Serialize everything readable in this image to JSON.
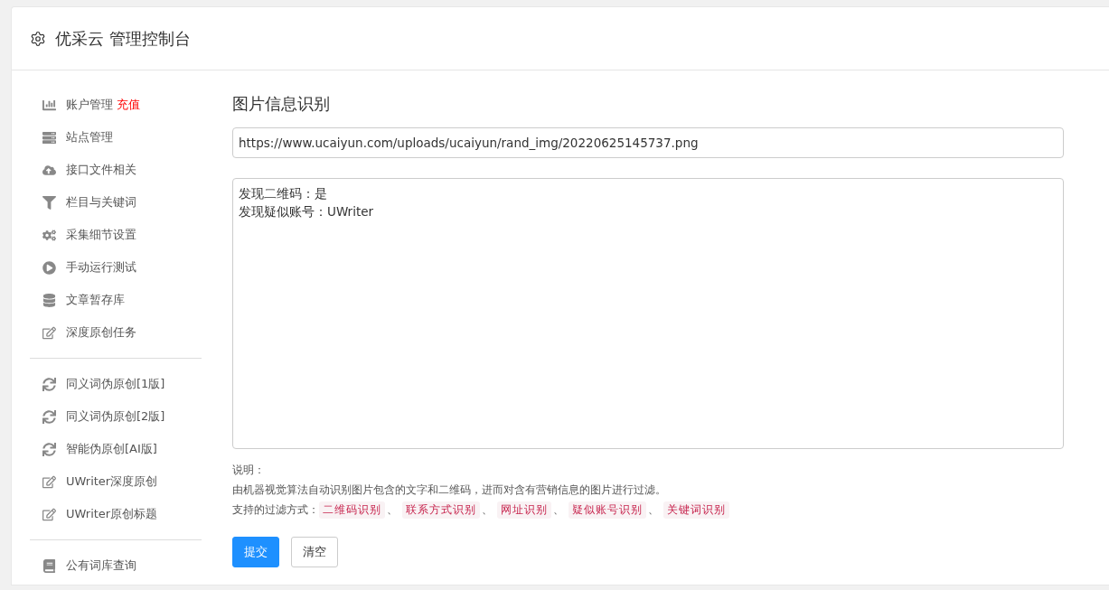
{
  "header": {
    "title": "优采云 管理控制台"
  },
  "sidebar": {
    "groups": [
      {
        "items": [
          {
            "kind": "chart",
            "label": "账户管理",
            "badge": "充值"
          },
          {
            "kind": "server",
            "label": "站点管理"
          },
          {
            "kind": "cloud",
            "label": "接口文件相关"
          },
          {
            "kind": "filter",
            "label": "栏目与关键词"
          },
          {
            "kind": "cogs",
            "label": "采集细节设置"
          },
          {
            "kind": "play",
            "label": "手动运行测试"
          },
          {
            "kind": "database",
            "label": "文章暂存库"
          },
          {
            "kind": "edit",
            "label": "深度原创任务"
          }
        ]
      },
      {
        "items": [
          {
            "kind": "sync",
            "label": "同义词伪原创[1版]"
          },
          {
            "kind": "sync",
            "label": "同义词伪原创[2版]"
          },
          {
            "kind": "sync",
            "label": "智能伪原创[AI版]"
          },
          {
            "kind": "edit",
            "label": "UWriter深度原创"
          },
          {
            "kind": "edit",
            "label": "UWriter原创标题"
          }
        ]
      },
      {
        "items": [
          {
            "kind": "book",
            "label": "公有词库查询"
          }
        ]
      }
    ]
  },
  "main": {
    "heading": "图片信息识别",
    "url_field": {
      "value": "https://www.ucaiyun.com/uploads/ucaiyun/rand_img/20220625145737.png"
    },
    "result_area": {
      "lines": [
        "发现二维码：是",
        "发现疑似账号：UWriter"
      ]
    },
    "notes_label": "说明：",
    "notes_text": "由机器视觉算法自动识别图片包含的文字和二维码，进而对含有营销信息的图片进行过滤。",
    "filters_label": "支持的过滤方式：",
    "filters": [
      {
        "label": "二维码识别",
        "separator": "、"
      },
      {
        "label": "联系方式识别",
        "separator": "、"
      },
      {
        "label": "网址识别",
        "separator": "、"
      },
      {
        "label": "疑似账号识别",
        "separator": "、"
      },
      {
        "label": "关键词识别"
      }
    ],
    "buttons": [
      {
        "label": "提交",
        "kind": "primary"
      },
      {
        "label": "清空",
        "kind": "default"
      }
    ]
  }
}
